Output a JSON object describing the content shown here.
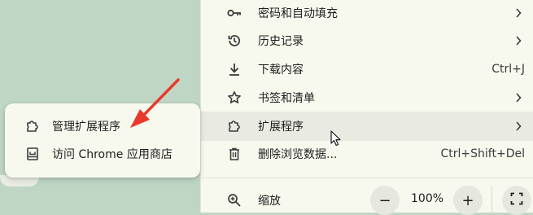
{
  "menu": {
    "items": [
      {
        "label": "密码和自动填充",
        "icon": "key-icon",
        "has_chevron": true
      },
      {
        "label": "历史记录",
        "icon": "history-icon",
        "has_chevron": true
      },
      {
        "label": "下载内容",
        "icon": "download-icon",
        "shortcut": "Ctrl+J"
      },
      {
        "label": "书签和清单",
        "icon": "star-icon",
        "has_chevron": true
      },
      {
        "label": "扩展程序",
        "icon": "puzzle-icon",
        "has_chevron": true
      },
      {
        "label": "删除浏览数据...",
        "icon": "trash-icon",
        "shortcut": "Ctrl+Shift+Del"
      }
    ],
    "zoom": {
      "label": "缩放",
      "value": "100%",
      "minus": "−",
      "plus": "+"
    }
  },
  "submenu": {
    "items": [
      {
        "label": "管理扩展程序",
        "icon": "puzzle-icon"
      },
      {
        "label": "访问 Chrome 应用商店",
        "icon": "store-icon"
      }
    ]
  },
  "colors": {
    "background": "#bfd6c4",
    "menu_bg": "#f7f8ee",
    "hover_bg": "#e9eae2",
    "annotation_arrow": "#e8392c"
  }
}
